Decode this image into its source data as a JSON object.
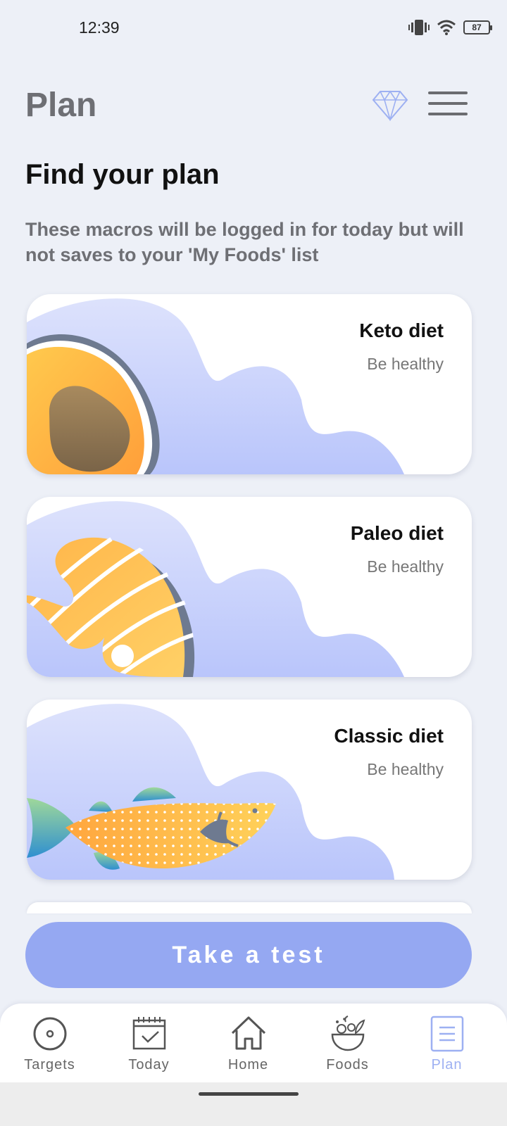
{
  "status": {
    "time": "12:39",
    "battery": "87"
  },
  "header": {
    "title": "Plan"
  },
  "section": {
    "title": "Find your plan",
    "description": "These macros will be logged in for today but will not saves to your 'My Foods' list"
  },
  "plans": [
    {
      "title": "Keto diet",
      "subtitle": "Be healthy",
      "illustration": "avocado"
    },
    {
      "title": "Paleo diet",
      "subtitle": "Be healthy",
      "illustration": "salmon-steak"
    },
    {
      "title": "Classic diet",
      "subtitle": "Be healthy",
      "illustration": "fish"
    }
  ],
  "cta": {
    "label": "Take a test"
  },
  "nav": [
    {
      "label": "Targets",
      "icon": "target-icon"
    },
    {
      "label": "Today",
      "icon": "calendar-check-icon"
    },
    {
      "label": "Home",
      "icon": "home-icon"
    },
    {
      "label": "Foods",
      "icon": "salad-bowl-icon"
    },
    {
      "label": "Plan",
      "icon": "plan-list-icon",
      "active": true
    }
  ],
  "colors": {
    "background": "#EDF0F7",
    "accent": "#95A8F2",
    "active_nav": "#9DB0F2",
    "wave": "#C3CDFB"
  }
}
